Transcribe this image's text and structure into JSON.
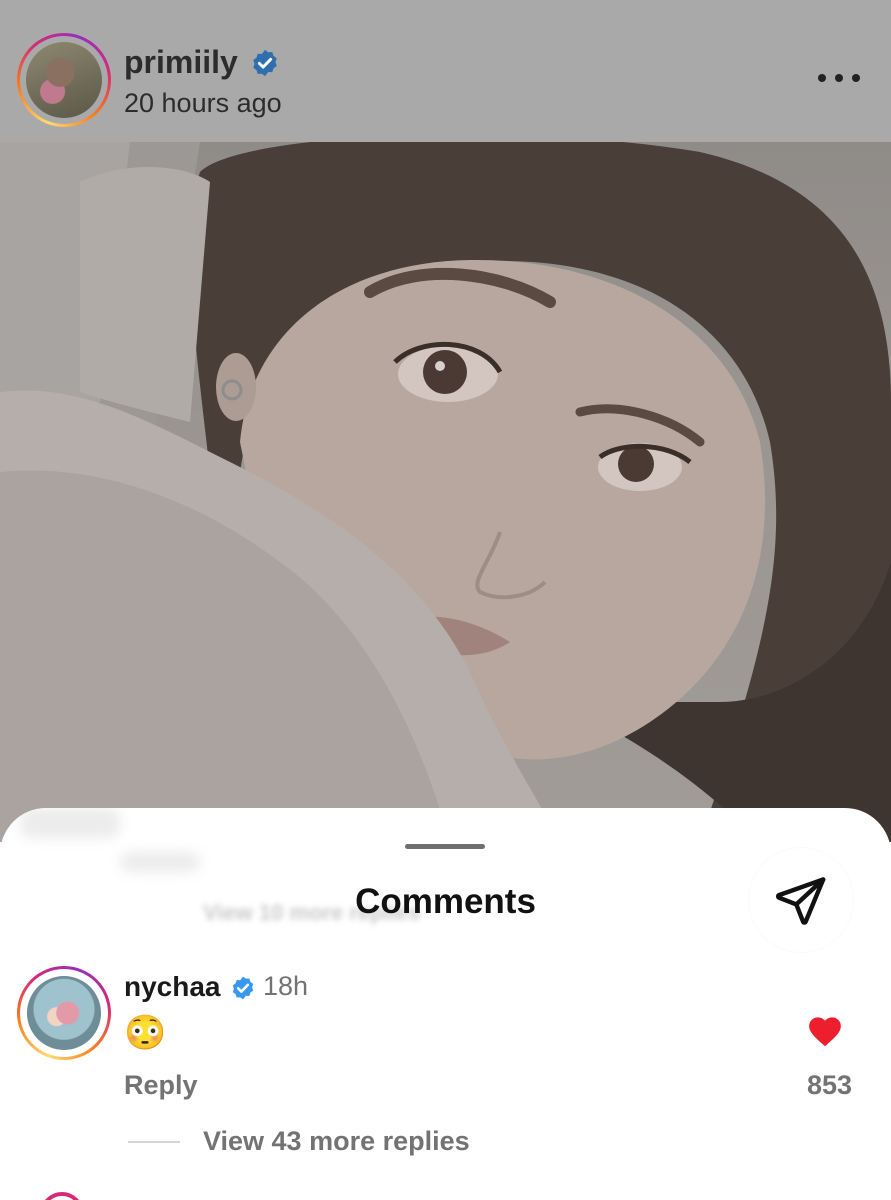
{
  "post": {
    "username": "primiily",
    "verified": true,
    "time": "20 hours ago"
  },
  "comments_sheet": {
    "title": "Comments",
    "ghost_text": "View 10 more replies",
    "comment": {
      "username": "nychaa",
      "verified": true,
      "time": "18h",
      "text": "😳",
      "reply_label": "Reply",
      "likes": "853",
      "liked": true,
      "view_replies_label": "View 43 more replies"
    }
  },
  "icons": {
    "more": "more-horizontal-icon",
    "verified": "verified-badge-icon",
    "share": "send-icon",
    "like": "heart-filled-icon"
  },
  "colors": {
    "verified_blue": "#3897f0",
    "like_red": "#ed1f2f",
    "secondary_text": "#737373",
    "overlay_gray": "#a9a9a9"
  }
}
